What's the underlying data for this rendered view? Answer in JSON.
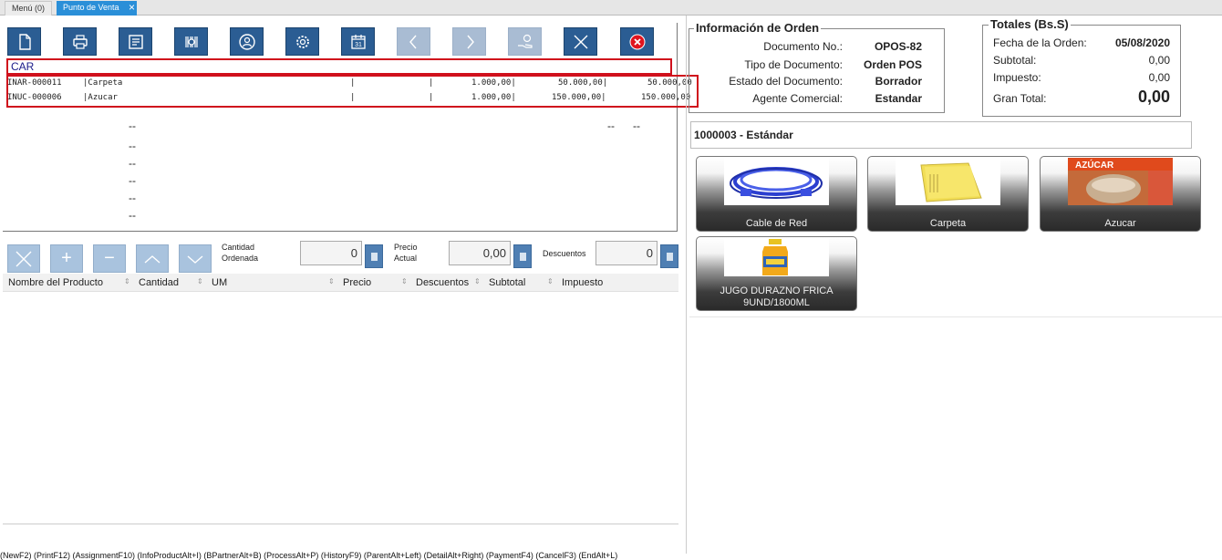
{
  "tabs": [
    {
      "label": "Menú (0)"
    },
    {
      "label": "Punto de Venta"
    }
  ],
  "toolbar": {
    "buttons": [
      {
        "icon": "new-document-icon"
      },
      {
        "icon": "print-icon"
      },
      {
        "icon": "assignment-icon"
      },
      {
        "icon": "barcode-info-icon"
      },
      {
        "icon": "business-partner-icon"
      },
      {
        "icon": "process-gear-icon"
      },
      {
        "icon": "history-calendar-icon",
        "text": "31"
      },
      {
        "icon": "previous-icon"
      },
      {
        "icon": "next-icon"
      },
      {
        "icon": "cancel-icon"
      },
      {
        "icon": "end-close-icon"
      }
    ]
  },
  "search": {
    "value": "CAR"
  },
  "search_results": [
    {
      "code": "INAR-000011",
      "name": "|Carpeta",
      "sep1": "|",
      "sep2": "|",
      "qty": "1.000,00|",
      "price": "50.000,00|",
      "total": "50.000,00"
    },
    {
      "code": "INUC-000006",
      "name": "|Azucar",
      "sep1": "|",
      "sep2": "|",
      "qty": "1.000,00|",
      "price": "150.000,00|",
      "total": "150.000,00"
    }
  ],
  "line_placeholders": {
    "dash": "--"
  },
  "controls": {
    "qty_label": "Cantidad\nOrdenada",
    "qty_value": "0",
    "price_label": "Precio\nActual",
    "price_value": "0,00",
    "discount_label": "Descuentos",
    "discount_value": "0",
    "plus": "+",
    "minus": "−"
  },
  "lines_table": {
    "columns": [
      "Nombre del Producto",
      "Cantidad",
      "UM",
      "Precio",
      "Descuentos",
      "Subtotal",
      "Impuesto"
    ]
  },
  "shortcuts": "(NewF2) (PrintF12) (AssignmentF10) (InfoProductAlt+I) (BPartnerAlt+B) (ProcessAlt+P) (HistoryF9) (ParentAlt+Left) (DetailAlt+Right) (PaymentF4) (CancelF3) (EndAlt+L)",
  "order_info": {
    "legend": "Información de Orden",
    "doc_no_label": "Documento No.:",
    "doc_no": "OPOS-82",
    "doc_type_label": "Tipo de Documento:",
    "doc_type": "Orden POS",
    "doc_status_label": "Estado del Documento:",
    "doc_status": "Borrador",
    "agent_label": "Agente Comercial:",
    "agent": "Estandar"
  },
  "totals": {
    "legend": "Totales (Bs.S)",
    "date_label": "Fecha de la Orden:",
    "date": "05/08/2020",
    "subtotal_label": "Subtotal:",
    "subtotal": "0,00",
    "tax_label": "Impuesto:",
    "tax": "0,00",
    "grand_label": "Gran Total:",
    "grand": "0,00"
  },
  "business_partner": {
    "value": "1000003 - Estándar"
  },
  "products": [
    {
      "name": "Cable de Red"
    },
    {
      "name": "Carpeta"
    },
    {
      "name": "Azucar"
    },
    {
      "name": "JUGO DURAZNO FRICA\n9UND/1800ML"
    }
  ],
  "colors": {
    "active_tab": "#2a8fd8",
    "toolbar_button": "#2b5d93",
    "highlight_border": "#d0101c",
    "cancel_red": "#e0141e"
  }
}
